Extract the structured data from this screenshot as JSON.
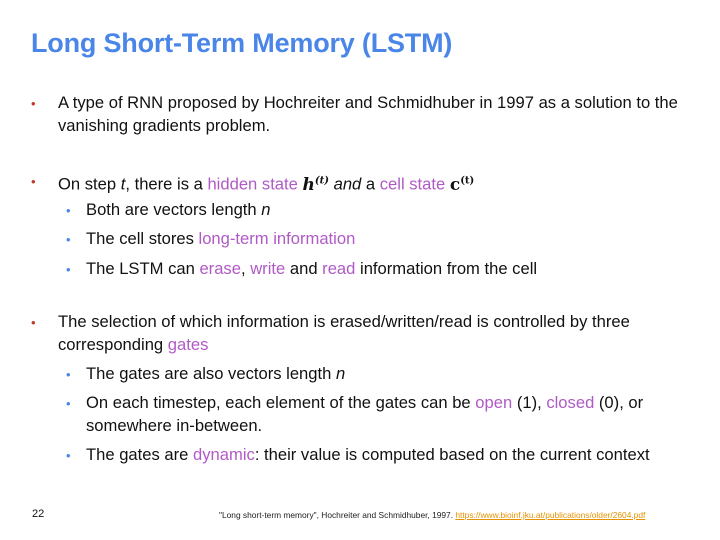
{
  "title": "Long Short-Term Memory (LSTM)",
  "b1": {
    "text": "A type of RNN proposed by Hochreiter and Schmidhuber in 1997 as a solution to the vanishing gradients problem."
  },
  "b2": {
    "pre": "On step ",
    "t": "t",
    "mid": ", there is a ",
    "hidden": "hidden state",
    "h_sym": "h",
    "h_sup": "(t)",
    "and": " and",
    "a": " a ",
    "cell": "cell state",
    "c_sym": "c",
    "c_sup": "(t)",
    "sub1_pre": "Both are vectors length ",
    "sub1_n": "n",
    "sub2_pre": "The cell stores ",
    "sub2_hl": "long-term information",
    "sub3_pre": "The LSTM can ",
    "erase": "erase",
    "comma": ",",
    "write": "write",
    "and2": " and ",
    "read": "read",
    "sub3_post": " information from the cell"
  },
  "b3": {
    "pre": "The selection of which information is erased/written/read is controlled by three corresponding ",
    "gates": "gates",
    "sub1_pre": "The gates are also vectors length ",
    "sub1_n": "n",
    "sub2_pre": "On each timestep, each element of the gates can be ",
    "open": "open",
    "open_val": " (1), ",
    "closed": "closed",
    "sub2_post": " (0), or somewhere in-between.",
    "sub3_pre": "The gates are ",
    "dynamic": "dynamic",
    "sub3_post": ": their value is computed based on the current context"
  },
  "page_number": "22",
  "footnote": {
    "text": "\"Long short-term memory\", Hochreiter and Schmidhuber, 1997. ",
    "link": "https://www.bioinf.jku.at/publications/older/2604.pdf"
  },
  "colors": {
    "title": "#4a86e8",
    "highlight": "#b05ac6",
    "bullet1": "#c0392b",
    "bullet2": "#4a86e8",
    "link": "#e69100"
  }
}
